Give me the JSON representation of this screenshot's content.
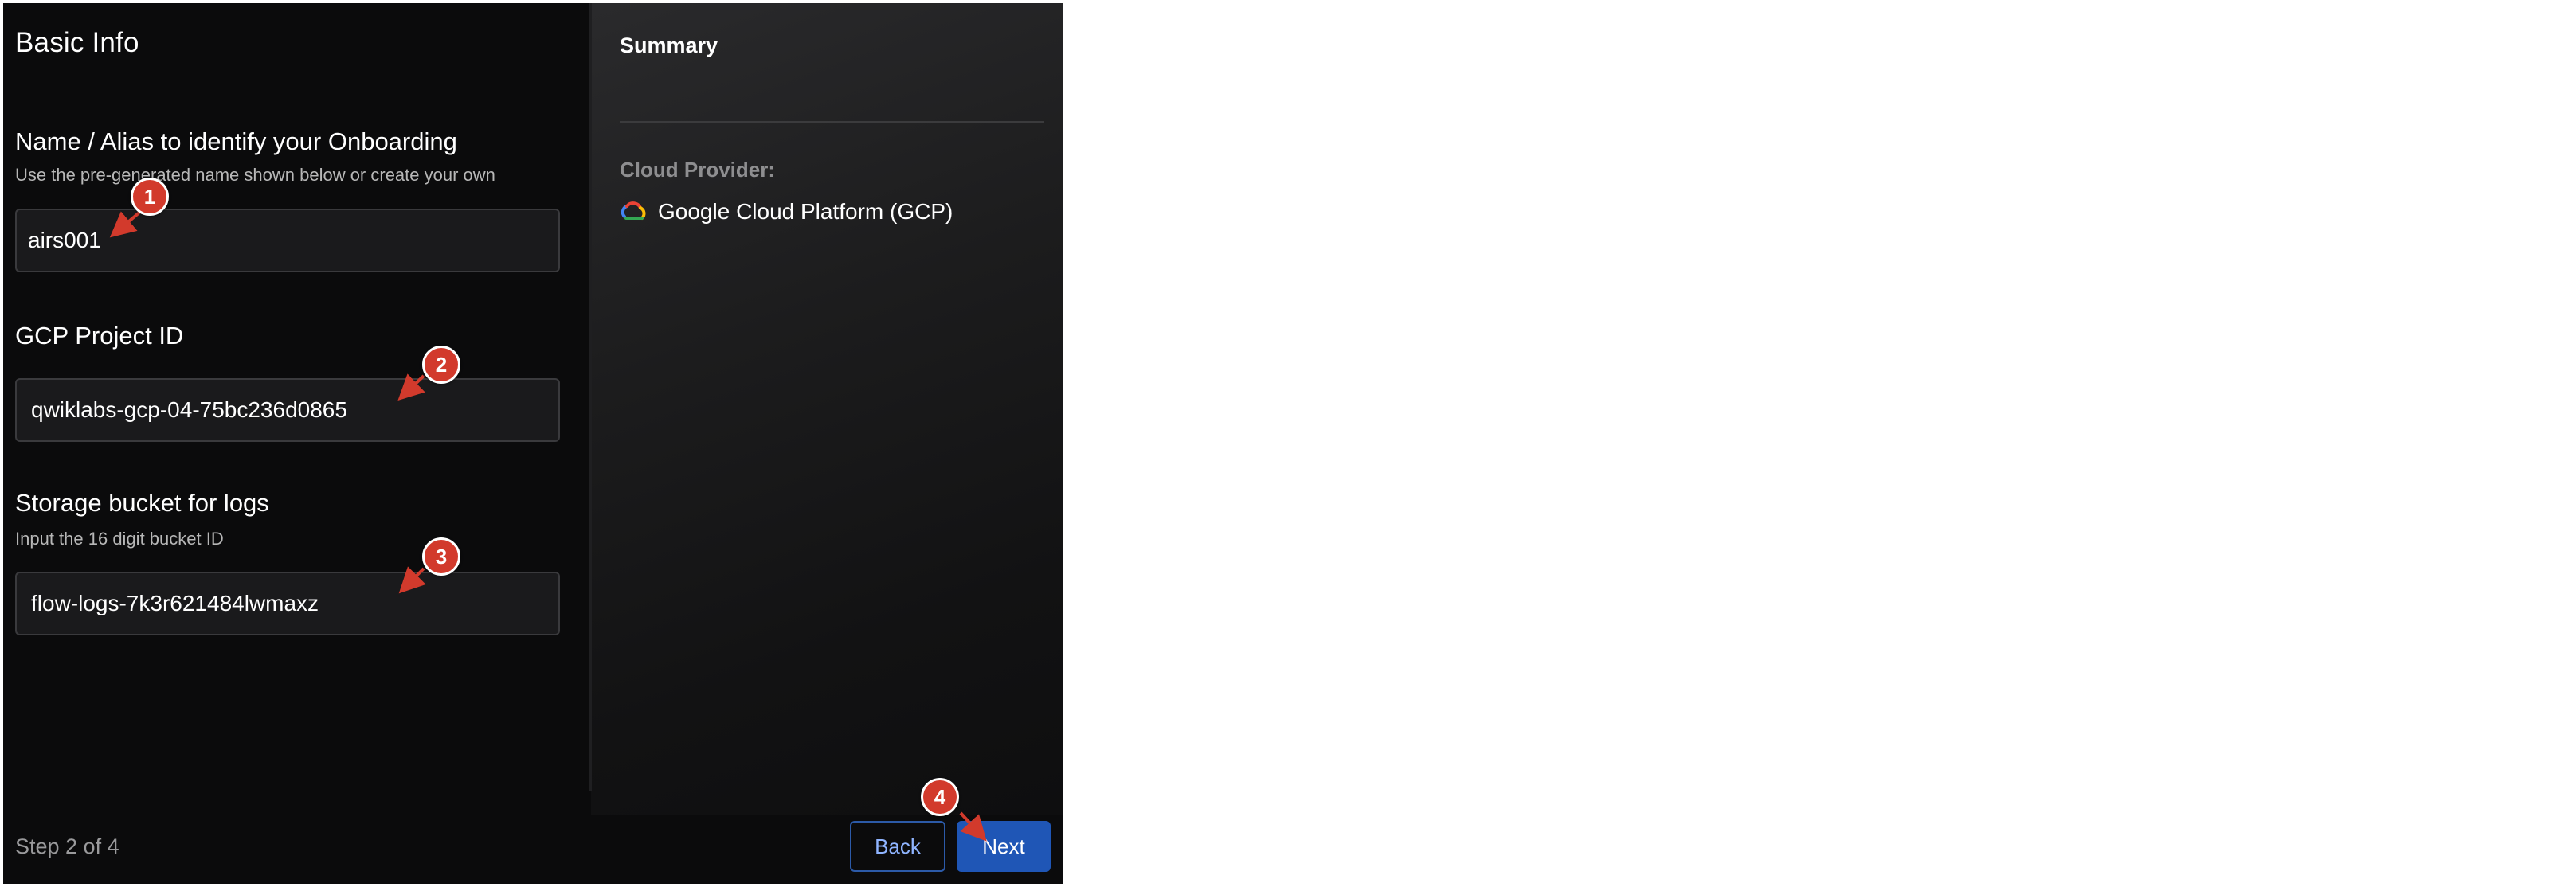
{
  "form": {
    "title": "Basic Info",
    "name_section": {
      "label": "Name / Alias to identify your Onboarding",
      "hint": "Use the pre-generated name shown below or create your own",
      "value": "airs001"
    },
    "project_section": {
      "label": "GCP Project ID",
      "value": "qwiklabs-gcp-04-75bc236d0865"
    },
    "storage_section": {
      "label": "Storage bucket for logs",
      "hint": "Input the 16 digit bucket ID",
      "value": "flow-logs-7k3r621484lwmaxz"
    }
  },
  "summary": {
    "title": "Summary",
    "cloud_provider_label": "Cloud Provider:",
    "cloud_provider_value": "Google Cloud Platform (GCP)",
    "cloud_provider_icon": "gcp-logo-icon"
  },
  "footer": {
    "step_text": "Step 2 of 4",
    "back_label": "Back",
    "next_label": "Next"
  },
  "annotations": {
    "markers": [
      "1",
      "2",
      "3",
      "4"
    ],
    "marker_color": "#d23a2c"
  },
  "colors": {
    "panel_bg": "#0b0b0c",
    "accent": "#1f56b6",
    "field_bg": "#1a1a1c"
  }
}
